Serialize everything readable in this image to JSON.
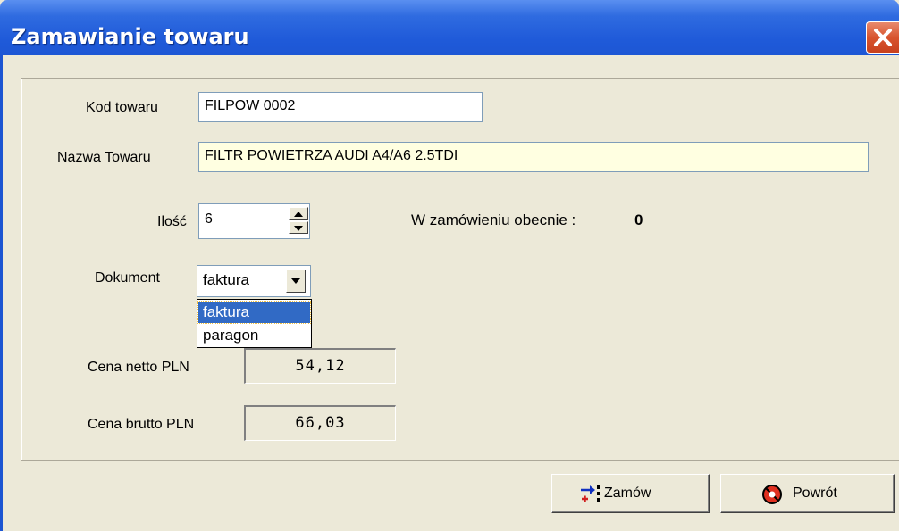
{
  "window": {
    "title": "Zamawianie towaru"
  },
  "form": {
    "kod_label": "Kod towaru",
    "kod_value": "FILPOW 0002",
    "nazwa_label": "Nazwa Towaru",
    "nazwa_value": "FILTR POWIETRZA AUDI A4/A6 2.5TDI",
    "ilosc_label": "Ilość",
    "ilosc_value": "6",
    "in_order_label": "W zamówieniu obecnie :",
    "in_order_value": "0",
    "dokument_label": "Dokument",
    "dokument_value": "faktura",
    "dokument_options": [
      "faktura",
      "paragon"
    ],
    "netto_label": "Cena netto PLN",
    "netto_value": "54,12",
    "brutto_label": "Cena brutto PLN",
    "brutto_value": "66,03"
  },
  "buttons": {
    "order_label": "Zamów",
    "back_label": "Powrót"
  },
  "icons": {
    "close": "close-icon",
    "order": "order-arrows-icon",
    "back": "stop-icon"
  }
}
